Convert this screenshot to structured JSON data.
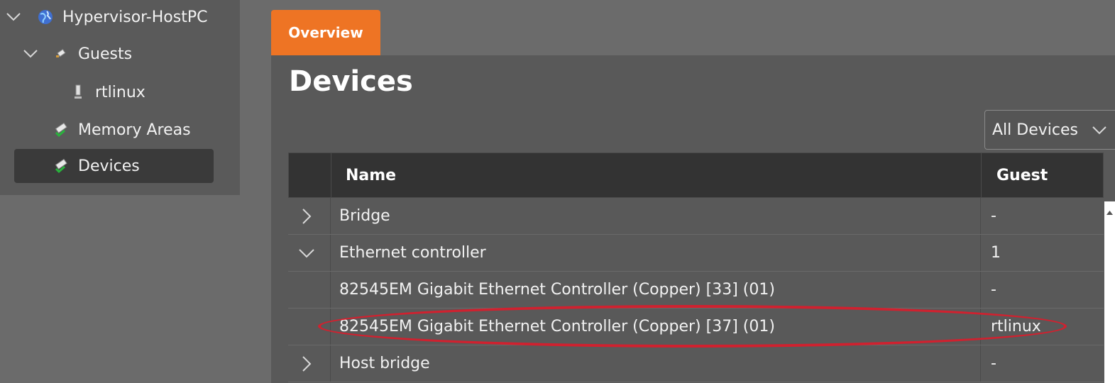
{
  "sidebar": {
    "root": {
      "label": "Hypervisor-HostPC",
      "icon": "globe-icon",
      "expanded": true
    },
    "items": [
      {
        "label": "Guests",
        "icon": "plug-icon",
        "expanded": true
      },
      {
        "label": "rtlinux",
        "icon": "plug-vertical-icon"
      },
      {
        "label": "Memory Areas",
        "icon": "chip-check-icon"
      },
      {
        "label": "Devices",
        "icon": "chip-check-icon",
        "selected": true
      }
    ]
  },
  "tabs": [
    {
      "label": "Overview",
      "active": true
    }
  ],
  "main": {
    "title": "Devices",
    "filter": {
      "selected": "All Devices",
      "icon": "chevron-down-icon"
    }
  },
  "table": {
    "columns": [
      "",
      "Name",
      "Guest"
    ],
    "rows": [
      {
        "name": "Bridge",
        "guest": "-",
        "expander": "collapsed"
      },
      {
        "name": "Ethernet controller",
        "guest": "1",
        "expander": "expanded"
      },
      {
        "name": "82545EM Gigabit Ethernet Controller (Copper) [33] (01)",
        "guest": "-",
        "expander": "none"
      },
      {
        "name": "82545EM Gigabit Ethernet Controller (Copper) [37] (01)",
        "guest": "rtlinux",
        "expander": "none",
        "annotated": true
      },
      {
        "name": "Host bridge",
        "guest": "-",
        "expander": "collapsed"
      }
    ]
  },
  "colors": {
    "accent": "#ee7424",
    "annotation": "#d0212f",
    "background": "#6b6b6b",
    "panel": "#595959",
    "header": "#333333",
    "selected": "#3a3a3a"
  }
}
